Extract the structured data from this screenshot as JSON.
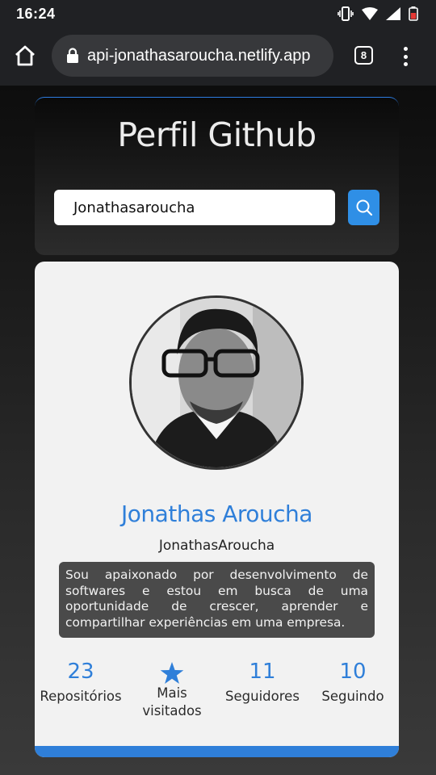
{
  "status_bar": {
    "time": "16:24",
    "icons": [
      "vibrate-icon",
      "wifi-icon",
      "signal-icon",
      "battery-icon"
    ]
  },
  "browser": {
    "url": "api-jonathasaroucha.netlify.app",
    "tab_count": "8"
  },
  "header": {
    "title": "Perfil Github",
    "search_value": "Jonathasaroucha"
  },
  "profile": {
    "name": "Jonathas Aroucha",
    "login": "JonathasAroucha",
    "bio": "Sou apaixonado por desenvolvimento de softwares e estou em busca de uma oportunidade de crescer, aprender e compartilhar experiências em uma empresa.",
    "stats": {
      "repos_value": "23",
      "repos_label": "Repositórios",
      "starred_label_line1": "Mais",
      "starred_label_line2": "visitados",
      "followers_value": "11",
      "followers_label": "Seguidores",
      "following_value": "10",
      "following_label": "Seguindo"
    }
  },
  "colors": {
    "accent": "#2f7fd9",
    "search_button": "#2f8fe6",
    "bio_background": "#4a4a4a",
    "card_background": "#f2f2f2"
  }
}
